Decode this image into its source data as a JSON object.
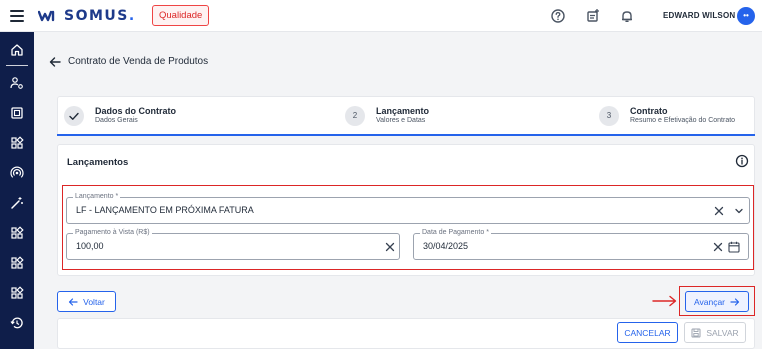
{
  "header": {
    "logo_text": "SOMUS",
    "logo_dot": ".",
    "module_badge": "Qualidade",
    "user_name": "EDWARD WILSON",
    "avatar_initials": "••"
  },
  "sidebar": {
    "items": [
      "home-icon",
      "users-settings-icon",
      "building-icon",
      "apps-icon",
      "broadcast-icon",
      "magic-wand-icon",
      "apps-icon",
      "apps-icon",
      "apps-icon",
      "history-icon"
    ]
  },
  "page": {
    "title": "Contrato de Venda de Produtos"
  },
  "stepper": {
    "steps": [
      {
        "number": "",
        "title": "Dados do Contrato",
        "subtitle": "Dados Gerais",
        "status": "done"
      },
      {
        "number": "2",
        "title": "Lançamento",
        "subtitle": "Valores e Datas",
        "status": "active"
      },
      {
        "number": "3",
        "title": "Contrato",
        "subtitle": "Resumo e Efetivação do Contrato",
        "status": "pending"
      }
    ]
  },
  "card": {
    "title": "Lançamentos",
    "lancamento": {
      "label": "Lançamento *",
      "value": "LF - LANÇAMENTO EM PRÓXIMA FATURA"
    },
    "pagamento_vista": {
      "label": "Pagamento à Vista (R$)",
      "value": "100,00"
    },
    "data_pagamento": {
      "label": "Data de Pagamento *",
      "value": "30/04/2025"
    }
  },
  "actions": {
    "back_label": "Voltar",
    "next_label": "Avançar",
    "cancel_label": "CANCELAR",
    "save_label": "SALVAR"
  },
  "colors": {
    "primary": "#2563eb",
    "sidebar": "#0f1e4a",
    "highlight": "#dc2626"
  }
}
